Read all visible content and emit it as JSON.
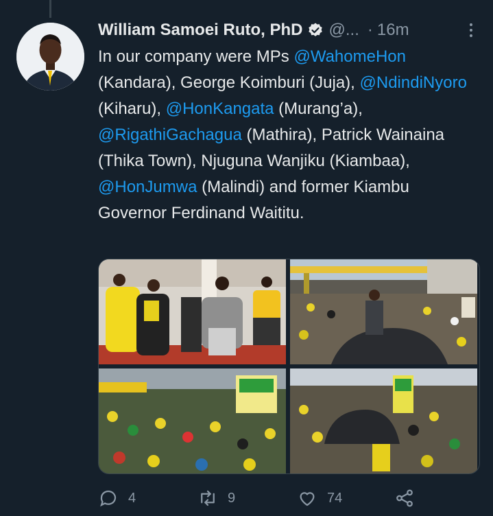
{
  "tweet": {
    "author_name": "William Samoei Ruto, PhD",
    "handle": "@...",
    "separator": "·",
    "time": "16m",
    "segments": [
      {
        "t": "In our company were MPs ",
        "link": false
      },
      {
        "t": "@WahomeHon",
        "link": true
      },
      {
        "t": " (Kandara), George Koimburi (Juja), ",
        "link": false
      },
      {
        "t": "@NdindiNyoro",
        "link": true
      },
      {
        "t": " (Kiharu), ",
        "link": false
      },
      {
        "t": "@HonKangata",
        "link": true
      },
      {
        "t": " (Murang’a), ",
        "link": false
      },
      {
        "t": "@RigathiGachagua",
        "link": true
      },
      {
        "t": " (Mathira), Patrick Wainaina (Thika Town), Njuguna Wanjiku (Kiambaa), ",
        "link": false
      },
      {
        "t": "@HonJumwa",
        "link": true
      },
      {
        "t": " (Malindi) and former Kiambu Governor Ferdinand Waititu.",
        "link": false
      }
    ]
  },
  "actions": {
    "reply_count": "4",
    "retweet_count": "9",
    "like_count": "74"
  },
  "colors": {
    "background": "#15202b",
    "link": "#1d9bf0",
    "muted": "#8b98a5",
    "text": "#e7e9ea"
  },
  "icons": [
    "verified-badge-icon",
    "more-icon",
    "reply-icon",
    "retweet-icon",
    "like-icon",
    "share-icon"
  ]
}
